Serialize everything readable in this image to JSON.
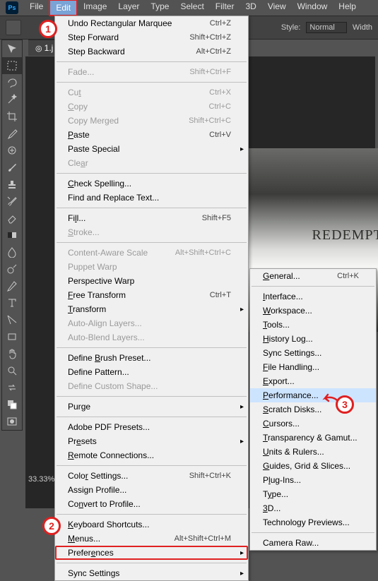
{
  "menubar": {
    "items": [
      "File",
      "Edit",
      "Image",
      "Layer",
      "Type",
      "Select",
      "Filter",
      "3D",
      "View",
      "Window",
      "Help"
    ],
    "openIndex": 1
  },
  "options": {
    "styleLabel": "Style:",
    "styleValue": "Normal",
    "widthLabel": "Width"
  },
  "docTab": "1.j",
  "canvasText": "REDEMPTIO",
  "status": "33.33%",
  "editMenu": [
    {
      "t": "row",
      "label": "Undo Rectangular Marquee",
      "sc": "Ctrl+Z"
    },
    {
      "t": "row",
      "label": "Step Forward",
      "sc": "Shift+Ctrl+Z"
    },
    {
      "t": "row",
      "label": "Step Backward",
      "sc": "Alt+Ctrl+Z"
    },
    {
      "t": "sep"
    },
    {
      "t": "row",
      "label": "Fade...",
      "sc": "Shift+Ctrl+F",
      "disabled": true
    },
    {
      "t": "sep"
    },
    {
      "t": "row",
      "label": "Cut",
      "sc": "Ctrl+X",
      "disabled": true,
      "u": 2
    },
    {
      "t": "row",
      "label": "Copy",
      "sc": "Ctrl+C",
      "disabled": true,
      "u": 0
    },
    {
      "t": "row",
      "label": "Copy Merged",
      "sc": "Shift+Ctrl+C",
      "disabled": true
    },
    {
      "t": "row",
      "label": "Paste",
      "sc": "Ctrl+V",
      "u": 0
    },
    {
      "t": "row",
      "label": "Paste Special",
      "arrow": true
    },
    {
      "t": "row",
      "label": "Clear",
      "disabled": true,
      "u": 3
    },
    {
      "t": "sep"
    },
    {
      "t": "row",
      "label": "Check Spelling...",
      "u": 0
    },
    {
      "t": "row",
      "label": "Find and Replace Text..."
    },
    {
      "t": "sep"
    },
    {
      "t": "row",
      "label": "Fill...",
      "sc": "Shift+F5",
      "u": 2
    },
    {
      "t": "row",
      "label": "Stroke...",
      "disabled": true,
      "u": 0
    },
    {
      "t": "sep"
    },
    {
      "t": "row",
      "label": "Content-Aware Scale",
      "sc": "Alt+Shift+Ctrl+C",
      "disabled": true
    },
    {
      "t": "row",
      "label": "Puppet Warp",
      "disabled": true
    },
    {
      "t": "row",
      "label": "Perspective Warp"
    },
    {
      "t": "row",
      "label": "Free Transform",
      "sc": "Ctrl+T",
      "u": 0
    },
    {
      "t": "row",
      "label": "Transform",
      "arrow": true,
      "u": 0
    },
    {
      "t": "row",
      "label": "Auto-Align Layers...",
      "disabled": true
    },
    {
      "t": "row",
      "label": "Auto-Blend Layers...",
      "disabled": true
    },
    {
      "t": "sep"
    },
    {
      "t": "row",
      "label": "Define Brush Preset...",
      "u": 7
    },
    {
      "t": "row",
      "label": "Define Pattern..."
    },
    {
      "t": "row",
      "label": "Define Custom Shape...",
      "disabled": true
    },
    {
      "t": "sep"
    },
    {
      "t": "row",
      "label": "Purge",
      "arrow": true,
      "u": 3
    },
    {
      "t": "sep"
    },
    {
      "t": "row",
      "label": "Adobe PDF Presets..."
    },
    {
      "t": "row",
      "label": "Presets",
      "arrow": true,
      "u": 2
    },
    {
      "t": "row",
      "label": "Remote Connections...",
      "u": 0
    },
    {
      "t": "sep"
    },
    {
      "t": "row",
      "label": "Color Settings...",
      "sc": "Shift+Ctrl+K",
      "u": 4
    },
    {
      "t": "row",
      "label": "Assign Profile..."
    },
    {
      "t": "row",
      "label": "Convert to Profile...",
      "u": 2
    },
    {
      "t": "sep"
    },
    {
      "t": "row",
      "label": "Keyboard Shortcuts...",
      "u": 0
    },
    {
      "t": "row",
      "label": "Menus...",
      "sc": "Alt+Shift+Ctrl+M",
      "u": 0
    },
    {
      "t": "row",
      "label": "Preferences",
      "arrow": true,
      "u": 6,
      "hl": "red"
    },
    {
      "t": "sep"
    },
    {
      "t": "row",
      "label": "Sync Settings",
      "arrow": true
    }
  ],
  "prefSubmenu": [
    {
      "t": "row",
      "label": "General...",
      "sc": "Ctrl+K",
      "u": 0
    },
    {
      "t": "sep"
    },
    {
      "t": "row",
      "label": "Interface...",
      "u": 0
    },
    {
      "t": "row",
      "label": "Workspace...",
      "u": 0
    },
    {
      "t": "row",
      "label": "Tools...",
      "u": 0
    },
    {
      "t": "row",
      "label": "History Log...",
      "u": 0
    },
    {
      "t": "row",
      "label": "Sync Settings..."
    },
    {
      "t": "row",
      "label": "File Handling...",
      "u": 0
    },
    {
      "t": "row",
      "label": "Export...",
      "u": 0
    },
    {
      "t": "row",
      "label": "Performance...",
      "u": 0,
      "hl": "blue"
    },
    {
      "t": "row",
      "label": "Scratch Disks...",
      "u": 0
    },
    {
      "t": "row",
      "label": "Cursors...",
      "u": 0
    },
    {
      "t": "row",
      "label": "Transparency & Gamut...",
      "u": 0
    },
    {
      "t": "row",
      "label": "Units & Rulers...",
      "u": 0
    },
    {
      "t": "row",
      "label": "Guides, Grid & Slices...",
      "u": 0
    },
    {
      "t": "row",
      "label": "Plug-Ins...",
      "u": 1
    },
    {
      "t": "row",
      "label": "Type...",
      "u": 1
    },
    {
      "t": "row",
      "label": "3D...",
      "u": 0
    },
    {
      "t": "row",
      "label": "Technology Previews..."
    },
    {
      "t": "sep"
    },
    {
      "t": "row",
      "label": "Camera Raw..."
    }
  ],
  "badges": {
    "1": "1",
    "2": "2",
    "3": "3"
  },
  "tools": [
    "move",
    "marquee",
    "lasso",
    "wand",
    "crop",
    "eyedropper",
    "heal",
    "brush",
    "stamp",
    "history",
    "eraser",
    "gradient",
    "blur",
    "dodge",
    "pen",
    "type",
    "path",
    "rect",
    "hand",
    "zoom",
    "swap",
    "fg-bg",
    "mask"
  ]
}
